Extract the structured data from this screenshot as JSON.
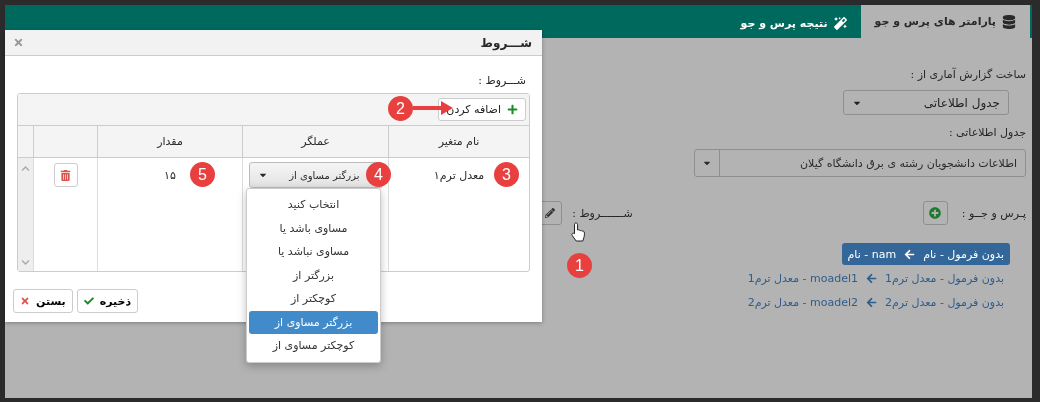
{
  "tabs": [
    {
      "label": "پارامتر های پرس و جو",
      "selected": true
    },
    {
      "label": "نتیجه پرس و جو",
      "selected": false
    }
  ],
  "report_source": {
    "label": "ساخت گزارش آماری از :",
    "value": "جدول اطلاعاتی"
  },
  "info_table": {
    "label": "جدول اطلاعاتی :",
    "value": "اطلاعات دانشجویان رشته ی برق دانشگاه گیلان"
  },
  "query": {
    "label": "پـرس و جــو :"
  },
  "conditions": {
    "label": "شـــــــروط :"
  },
  "fields": [
    {
      "source": "بدون فرمول - نام",
      "target": "nam - نام",
      "selected": true
    },
    {
      "source": "بدون فرمول - معدل ترم1",
      "target": "moadel1 - معدل ترم1",
      "selected": false
    },
    {
      "source": "بدون فرمول - معدل ترم2",
      "target": "moadel2 - معدل ترم2",
      "selected": false
    }
  ],
  "dialog": {
    "title": "شـــروط",
    "section_label": "شـــروط :",
    "add_button": "اضافه کردن",
    "columns": [
      "نام متغیر",
      "عملگر",
      "مقدار"
    ],
    "rows": [
      {
        "variable": "معدل ترم۱",
        "operator": "بزرگتر مساوی از",
        "value": "۱۵"
      }
    ],
    "operator_options": [
      {
        "label": "انتخاب کنید",
        "selected": false
      },
      {
        "label": "مساوی باشد یا",
        "selected": false
      },
      {
        "label": "مساوی نباشد یا",
        "selected": false
      },
      {
        "label": "بزرگتر از",
        "selected": false
      },
      {
        "label": "کوچکتر از",
        "selected": false
      },
      {
        "label": "بزرگتر مساوی از",
        "selected": true
      },
      {
        "label": "کوچکتر مساوی از",
        "selected": false
      }
    ],
    "buttons": [
      {
        "kind": "save",
        "label": "ذخیره"
      },
      {
        "kind": "close",
        "label": "بستن"
      }
    ]
  },
  "annotations": [
    {
      "label": "1",
      "kind": "plain"
    },
    {
      "label": "2",
      "kind": "arrow"
    },
    {
      "label": "3",
      "kind": "plain"
    },
    {
      "label": "4",
      "kind": "plain"
    },
    {
      "label": "5",
      "kind": "plain"
    }
  ]
}
